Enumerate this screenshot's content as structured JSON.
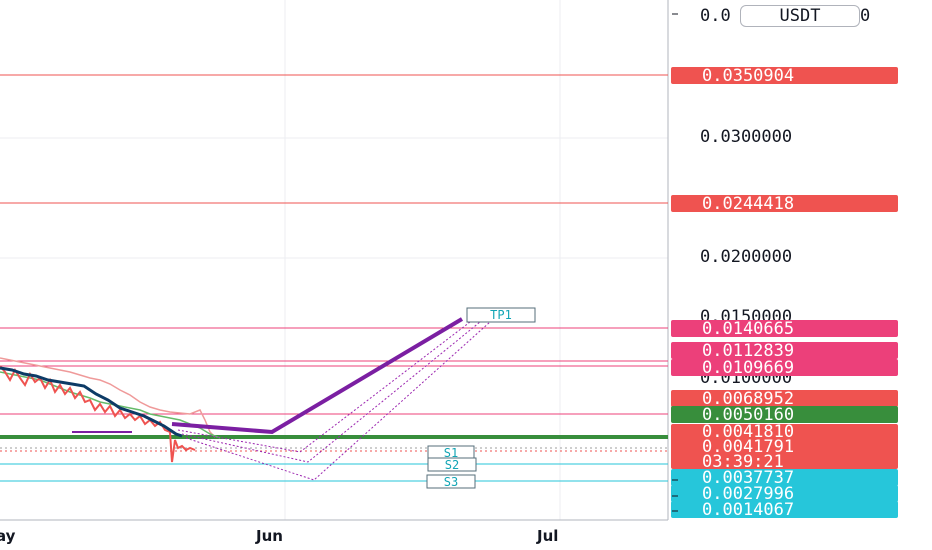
{
  "currency_badge": "USDT",
  "price_axis": {
    "partial_top": "0.0",
    "partial_top_right": "0",
    "ticks": [
      "0.0300000",
      "0.0200000",
      "0.0150000",
      "0.0100000"
    ]
  },
  "price_tags": [
    {
      "text": "0.0350904",
      "color": "#ef5350"
    },
    {
      "text": "0.0244418",
      "color": "#ef5350"
    },
    {
      "text": "0.0140665",
      "color": "#ec407a"
    },
    {
      "text": "0.0112839",
      "color": "#ec407a"
    },
    {
      "text": "0.0109669",
      "color": "#ec407a"
    },
    {
      "text": "0.0068952",
      "color": "#ef5350"
    },
    {
      "text": "0.0050160",
      "color": "#388e3c"
    },
    {
      "text": "0.0041810",
      "color": "#ef5350"
    },
    {
      "text": "0.0041791",
      "color": "#ef5350"
    },
    {
      "text": "03:39:21",
      "color": "#ef5350"
    },
    {
      "text": "0.0037737",
      "color": "#26c6da"
    },
    {
      "text": "0.0027996",
      "color": "#26c6da"
    },
    {
      "text": "0.0014067",
      "color": "#26c6da"
    }
  ],
  "time_axis": [
    "ay",
    "Jun",
    "Jul"
  ],
  "level_labels": [
    "TP1",
    "S1",
    "S2",
    "S3"
  ],
  "colors": {
    "resistance": "#ef5350",
    "pink_level": "#ec407a",
    "support": "#26c6da",
    "base_line": "#388e3c",
    "projection": "#7b1fa2",
    "candle_down": "#ef5350",
    "trend_line": "#0d3b66"
  }
}
